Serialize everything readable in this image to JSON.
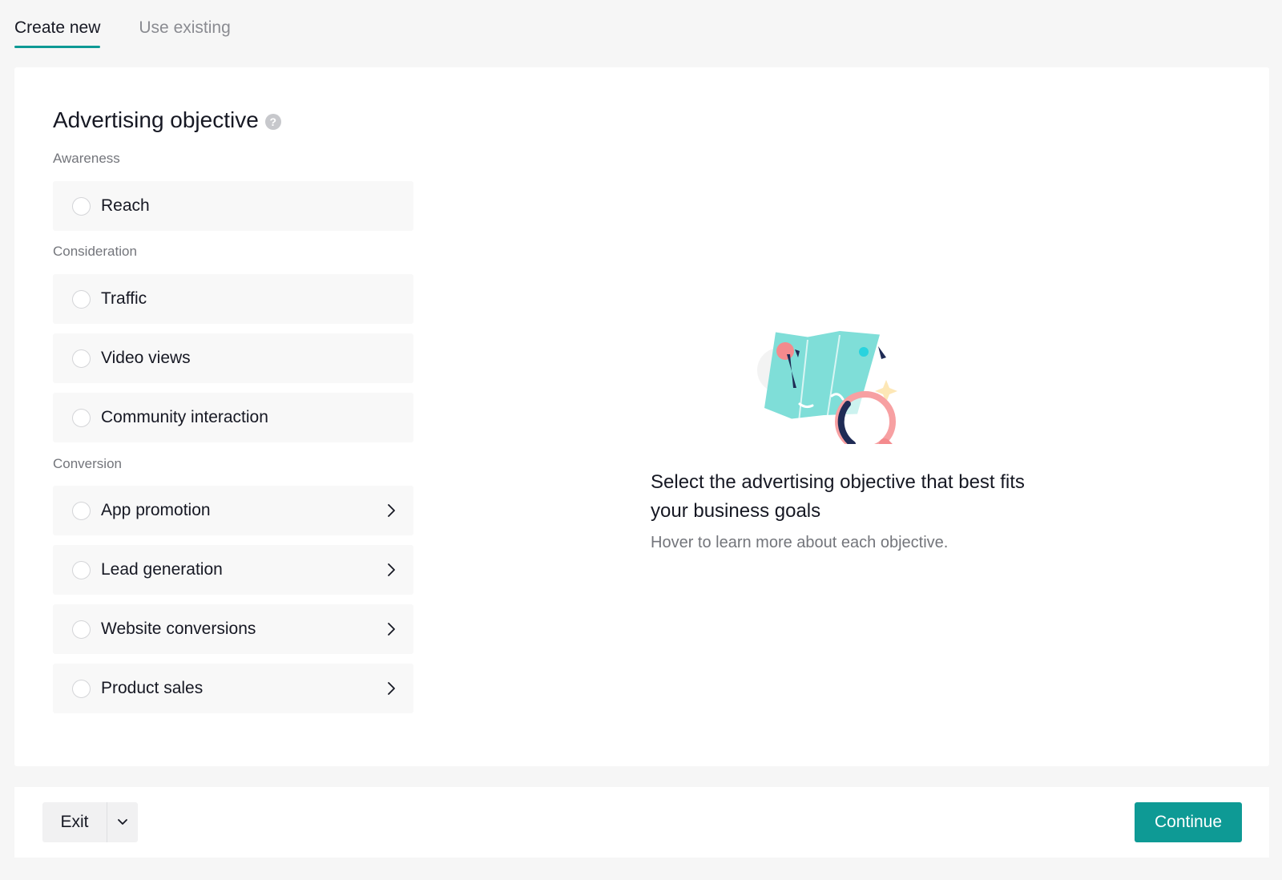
{
  "tabs": [
    {
      "label": "Create new",
      "active": true
    },
    {
      "label": "Use existing",
      "active": false
    }
  ],
  "objective": {
    "title": "Advertising objective",
    "help_icon": "question-circle-icon",
    "groups": [
      {
        "label": "Awareness",
        "options": [
          {
            "label": "Reach",
            "has_submenu": false
          }
        ]
      },
      {
        "label": "Consideration",
        "options": [
          {
            "label": "Traffic",
            "has_submenu": false
          },
          {
            "label": "Video views",
            "has_submenu": false
          },
          {
            "label": "Community interaction",
            "has_submenu": false
          }
        ]
      },
      {
        "label": "Conversion",
        "options": [
          {
            "label": "App promotion",
            "has_submenu": true
          },
          {
            "label": "Lead generation",
            "has_submenu": true
          },
          {
            "label": "Website conversions",
            "has_submenu": true
          },
          {
            "label": "Product sales",
            "has_submenu": true
          }
        ]
      }
    ]
  },
  "info": {
    "illustration": "map-magnifier-illustration",
    "title": "Select the advertising objective that best fits your business goals",
    "subtitle": "Hover to learn more about each objective."
  },
  "footer": {
    "exit_label": "Exit",
    "continue_label": "Continue"
  },
  "colors": {
    "accent": "#0e9a95",
    "page_background": "#f6f6f6",
    "option_background": "#f8f8f8"
  }
}
